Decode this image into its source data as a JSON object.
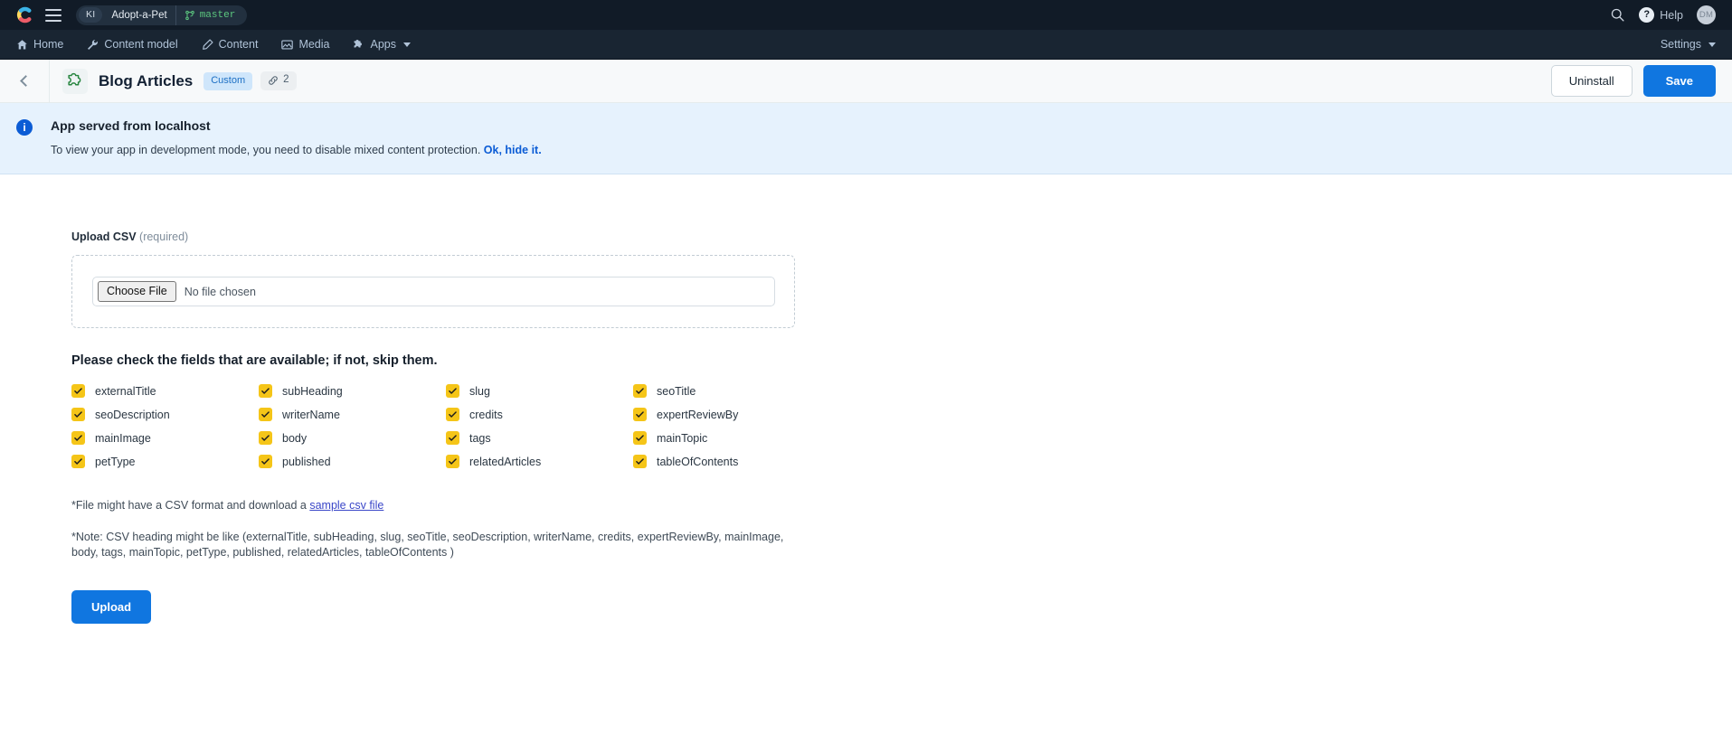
{
  "topbar": {
    "logo_icon": "contentful-logo-icon",
    "menu_icon": "hamburger-menu-icon",
    "org_initials": "KI",
    "space_name": "Adopt-a-Pet",
    "branch_icon": "git-branch-icon",
    "branch_name": "master",
    "search_icon": "search-icon",
    "help_icon": "question-mark-icon",
    "help_label": "Help",
    "avatar_initials": "DM"
  },
  "nav": {
    "items": [
      {
        "label": "Home",
        "icon": "home-icon"
      },
      {
        "label": "Content model",
        "icon": "wrench-icon"
      },
      {
        "label": "Content",
        "icon": "pen-icon"
      },
      {
        "label": "Media",
        "icon": "image-icon"
      },
      {
        "label": "Apps",
        "icon": "puzzle-icon",
        "caret": true
      }
    ],
    "settings_label": "Settings"
  },
  "page_header": {
    "back_icon": "chevron-left-icon",
    "app_icon": "puzzle-piece-icon",
    "title": "Blog Articles",
    "badge_custom": "Custom",
    "link_icon": "link-icon",
    "link_count": "2",
    "uninstall_label": "Uninstall",
    "save_label": "Save"
  },
  "banner": {
    "info_icon": "info-icon",
    "info_glyph": "i",
    "title": "App served from localhost",
    "message": "To view your app in development mode, you need to disable mixed content protection.",
    "link_label": "Ok, hide it."
  },
  "form": {
    "upload_label": "Upload CSV",
    "upload_required": "(required)",
    "choose_file_label": "Choose File",
    "no_file_text": "No file chosen",
    "check_heading": "Please check the fields that are available; if not, skip them.",
    "fields": [
      {
        "label": "externalTitle",
        "checked": true
      },
      {
        "label": "subHeading",
        "checked": true
      },
      {
        "label": "slug",
        "checked": true
      },
      {
        "label": "seoTitle",
        "checked": true
      },
      {
        "label": "seoDescription",
        "checked": true
      },
      {
        "label": "writerName",
        "checked": true
      },
      {
        "label": "credits",
        "checked": true
      },
      {
        "label": "expertReviewBy",
        "checked": true
      },
      {
        "label": "mainImage",
        "checked": true
      },
      {
        "label": "body",
        "checked": true
      },
      {
        "label": "tags",
        "checked": true
      },
      {
        "label": "mainTopic",
        "checked": true
      },
      {
        "label": "petType",
        "checked": true
      },
      {
        "label": "published",
        "checked": true
      },
      {
        "label": "relatedArticles",
        "checked": true
      },
      {
        "label": "tableOfContents",
        "checked": true
      }
    ],
    "note1_prefix": "*File might have a CSV format and download a ",
    "note1_link": "sample csv file",
    "note2": "*Note: CSV heading might be like (externalTitle, subHeading, slug, seoTitle, seoDescription, writerName, credits, expertReviewBy, mainImage, body, tags, mainTopic, petType, published, relatedArticles, tableOfContents )",
    "upload_button": "Upload"
  },
  "colors": {
    "accent_blue": "#1076e0",
    "checkbox_yellow": "#f5c518",
    "banner_bg": "#e6f2fd",
    "topbar_bg": "#111b27",
    "branch_green": "#5cc77f"
  }
}
